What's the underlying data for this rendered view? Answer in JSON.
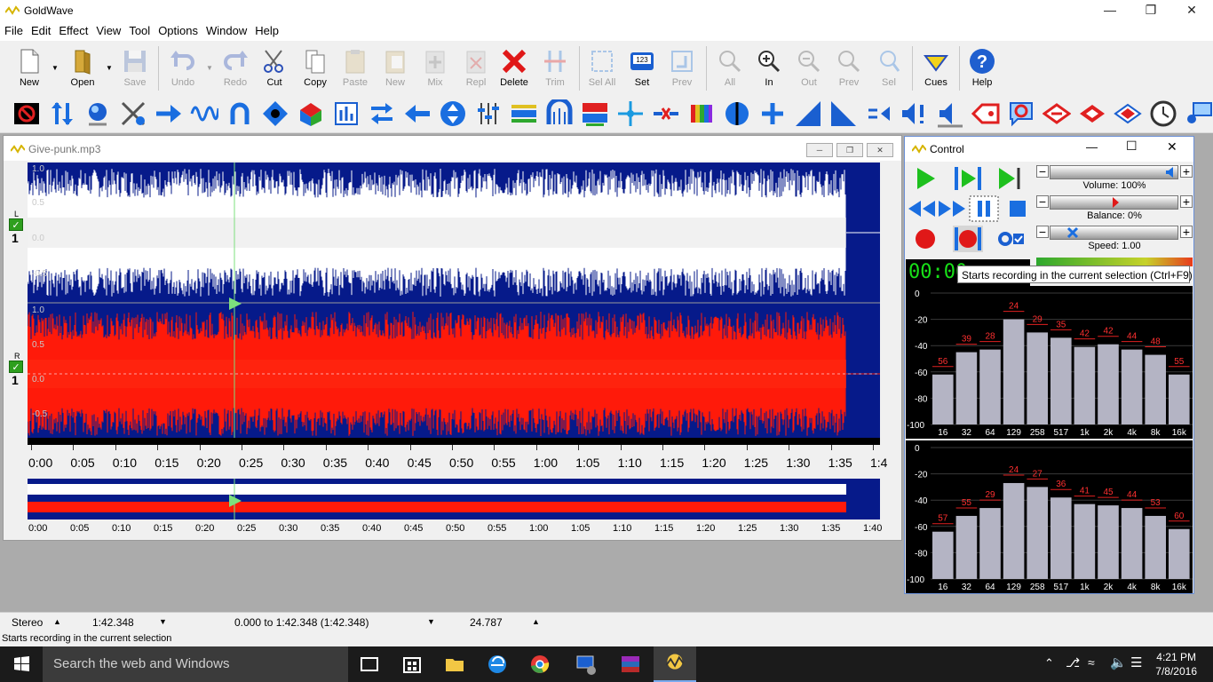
{
  "app": {
    "title": "GoldWave"
  },
  "menu": [
    "File",
    "Edit",
    "Effect",
    "View",
    "Tool",
    "Options",
    "Window",
    "Help"
  ],
  "toolbar": [
    {
      "label": "New",
      "enabled": true
    },
    {
      "label": "Open",
      "enabled": true
    },
    {
      "label": "Save",
      "enabled": false
    },
    {
      "label": "Undo",
      "enabled": false
    },
    {
      "label": "Redo",
      "enabled": false
    },
    {
      "label": "Cut",
      "enabled": true
    },
    {
      "label": "Copy",
      "enabled": true
    },
    {
      "label": "Paste",
      "enabled": false
    },
    {
      "label": "New",
      "enabled": false
    },
    {
      "label": "Mix",
      "enabled": false
    },
    {
      "label": "Repl",
      "enabled": false
    },
    {
      "label": "Delete",
      "enabled": true
    },
    {
      "label": "Trim",
      "enabled": false
    },
    {
      "label": "Sel All",
      "enabled": false
    },
    {
      "label": "Set",
      "enabled": true
    },
    {
      "label": "Prev",
      "enabled": false
    },
    {
      "label": "All",
      "enabled": false
    },
    {
      "label": "In",
      "enabled": true
    },
    {
      "label": "Out",
      "enabled": false
    },
    {
      "label": "Prev",
      "enabled": false
    },
    {
      "label": "Sel",
      "enabled": false
    },
    {
      "label": "Cues",
      "enabled": true
    },
    {
      "label": "Help",
      "enabled": true
    }
  ],
  "document": {
    "title": "Give-punk.mp3",
    "channels": [
      {
        "label": "L",
        "number": "1",
        "axis": [
          "1.0",
          "0.5",
          "0.0",
          "-0.5"
        ]
      },
      {
        "label": "R",
        "number": "1",
        "axis": [
          "1.0",
          "0.5",
          "0.0",
          "-0.5"
        ]
      }
    ],
    "timeline": [
      "0:00",
      "0:05",
      "0:10",
      "0:15",
      "0:20",
      "0:25",
      "0:30",
      "0:35",
      "0:40",
      "0:45",
      "0:50",
      "0:55",
      "1:00",
      "1:05",
      "1:10",
      "1:15",
      "1:20",
      "1:25",
      "1:30",
      "1:35",
      "1:4"
    ],
    "overview_timeline": [
      "0:00",
      "0:05",
      "0:10",
      "0:15",
      "0:20",
      "0:25",
      "0:30",
      "0:35",
      "0:40",
      "0:45",
      "0:50",
      "0:55",
      "1:00",
      "1:05",
      "1:10",
      "1:15",
      "1:20",
      "1:25",
      "1:30",
      "1:35",
      "1:40"
    ],
    "colors": {
      "left": "#ffffff",
      "right": "#ff1a0a",
      "background": "#061a8a"
    }
  },
  "control": {
    "title": "Control",
    "volume_label": "Volume: 100%",
    "balance_label": "Balance: 0%",
    "speed_label": "Speed: 1.00",
    "time_display": "00:00",
    "tooltip": "Starts recording in the current selection (Ctrl+F9)",
    "spectrum_top": {
      "yticks": [
        "0",
        "-20",
        "-40",
        "-60",
        "-80",
        "-100"
      ],
      "bands": [
        "16",
        "32",
        "64",
        "129",
        "258",
        "517",
        "1k",
        "2k",
        "4k",
        "8k",
        "16k"
      ],
      "peaks": [
        "56",
        "39",
        "28",
        "24",
        "29",
        "35",
        "42",
        "42",
        "44",
        "48",
        "55"
      ],
      "levels": [
        -62,
        -45,
        -43,
        -20,
        -30,
        -34,
        -41,
        -39,
        -43,
        -47,
        -62
      ]
    },
    "spectrum_bottom": {
      "yticks": [
        "0",
        "-20",
        "-40",
        "-60",
        "-80",
        "-100"
      ],
      "bands": [
        "16",
        "32",
        "64",
        "129",
        "258",
        "517",
        "1k",
        "2k",
        "4k",
        "8k",
        "16k"
      ],
      "peaks": [
        "57",
        "55",
        "29",
        "24",
        "27",
        "36",
        "41",
        "45",
        "44",
        "53",
        "60"
      ],
      "levels": [
        -64,
        -52,
        -46,
        -27,
        -30,
        -38,
        -43,
        -44,
        -46,
        -52,
        -62
      ]
    }
  },
  "status": {
    "channels": "Stereo",
    "length": "1:42.348",
    "selection": "0.000 to 1:42.348 (1:42.348)",
    "position": "24.787",
    "hint": "Starts recording in the current selection"
  },
  "taskbar": {
    "search_placeholder": "Search the web and Windows",
    "time": "4:21 PM",
    "date": "7/8/2016"
  }
}
